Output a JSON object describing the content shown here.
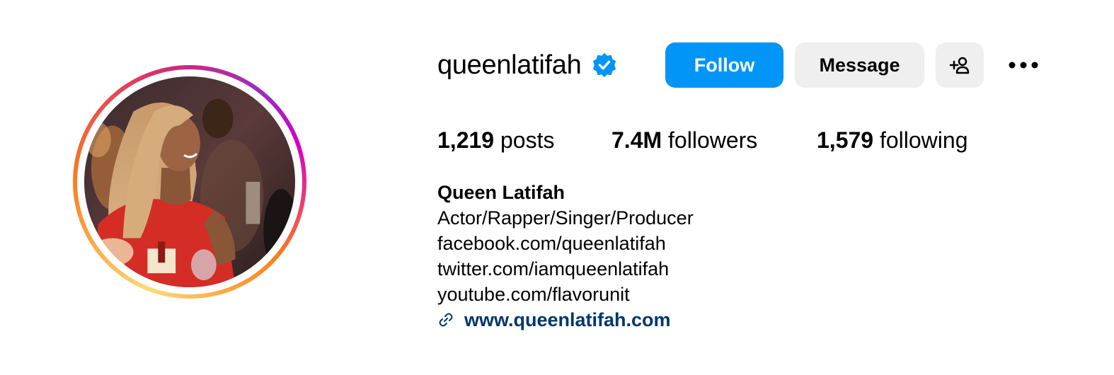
{
  "profile": {
    "username": "queenlatifah",
    "verified": true,
    "avatar_alt": "profile-photo",
    "accent_color": "#0095f6"
  },
  "actions": {
    "follow_label": "Follow",
    "message_label": "Message",
    "add_user_icon": "add-person-icon",
    "more_icon": "more-options-icon"
  },
  "stats": [
    {
      "count": "1,219",
      "label": "posts"
    },
    {
      "count": "7.4M",
      "label": "followers"
    },
    {
      "count": "1,579",
      "label": "following"
    }
  ],
  "bio": {
    "full_name": "Queen Latifah",
    "lines": [
      "Actor/Rapper/Singer/Producer",
      "facebook.com/queenlatifah",
      "twitter.com/iamqueenlatifah",
      "youtube.com/flavorunit"
    ],
    "website": "www.queenlatifah.com",
    "link_color": "#00376b"
  }
}
